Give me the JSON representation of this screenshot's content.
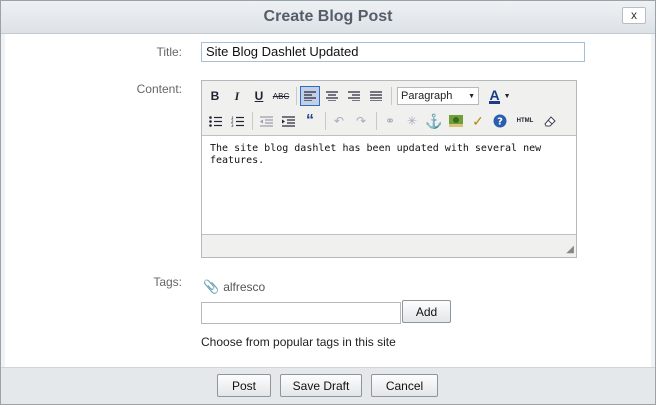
{
  "dialog": {
    "title": "Create Blog Post",
    "close_label": "x"
  },
  "form": {
    "title_label": "Title:",
    "title_value": "Site Blog Dashlet Updated",
    "content_label": "Content:",
    "content_text": "The site blog dashlet has been updated with several new features.",
    "tags_label": "Tags:",
    "tag_name": "alfresco",
    "tag_input_value": "",
    "add_label": "Add",
    "popular_tags_link": "Choose from popular tags in this site"
  },
  "toolbar": {
    "bold": "B",
    "italic": "I",
    "underline": "U",
    "strike": "ABC",
    "paragraph": "Paragraph",
    "font_color": "A",
    "blockquote": "“",
    "html": "HTML"
  },
  "footer": {
    "post_label": "Post",
    "save_draft_label": "Save Draft",
    "cancel_label": "Cancel"
  }
}
